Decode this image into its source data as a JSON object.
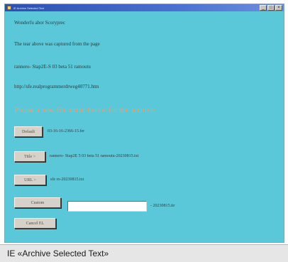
{
  "window": {
    "title": "IE Archive Selected Text",
    "controls": [
      "_",
      "□",
      "×"
    ]
  },
  "content": {
    "line1": "Wonderfu abor Scoryprec",
    "line2": "The tear above was captured from the page",
    "line3": "rannero- Stap2E-S 03 beta 51 ramoutu",
    "line4": "http://sfe.realprogrammerdrweg40771.htm",
    "heading": "Please a new file name below for the archive:"
  },
  "actions": {
    "default_label": "Default",
    "default_value": "03-16-16-2366-15.fer",
    "title_label": "Title >",
    "title_value": "rannero- Stap2E 5 03 beta 51 ramoutu-20230815.txt",
    "url_label": "URL >",
    "url_value": "sfe ro-20230815.txt",
    "custom_label": "Custom",
    "custom_value": "",
    "custom_suffix": "- 20230815.ttr",
    "cancel_label": "Cancel EL"
  },
  "caption": {
    "text": "IE «Archive Selected Text»"
  }
}
